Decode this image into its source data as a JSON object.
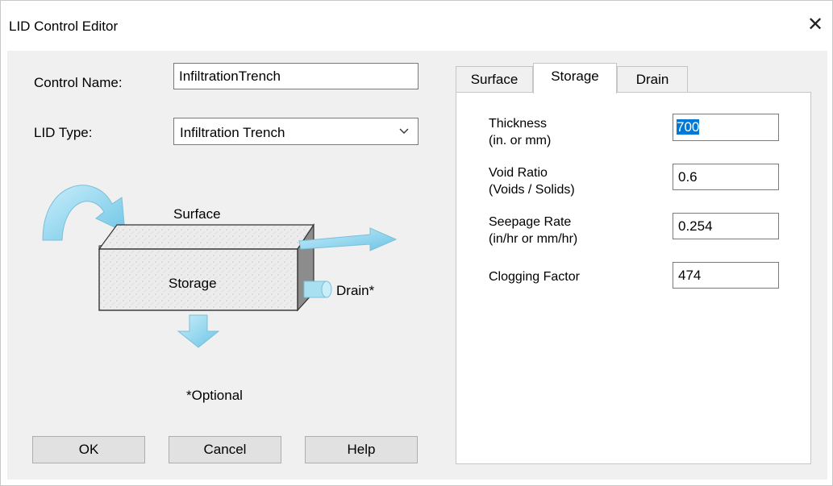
{
  "window": {
    "title": "LID Control Editor",
    "close_glyph": "✕"
  },
  "form": {
    "control_name_label": "Control Name:",
    "control_name_value": "InfiltrationTrench",
    "lid_type_label": "LID Type:",
    "lid_type_value": "Infiltration Trench"
  },
  "diagram": {
    "surface_label": "Surface",
    "storage_label": "Storage",
    "drain_label": "Drain*",
    "optional_note": "*Optional"
  },
  "buttons": {
    "ok_label": "OK",
    "cancel_label": "Cancel",
    "help_label": "Help"
  },
  "tabs": [
    {
      "label": "Surface",
      "active": false
    },
    {
      "label": "Storage",
      "active": true
    },
    {
      "label": "Drain",
      "active": false
    }
  ],
  "storage": {
    "fields": [
      {
        "label_line1": "Thickness",
        "label_line2": "(in. or mm)",
        "value": "700"
      },
      {
        "label_line1": "Void Ratio",
        "label_line2": "(Voids / Solids)",
        "value": "0.6"
      },
      {
        "label_line1": "Seepage Rate",
        "label_line2": "(in/hr or mm/hr)",
        "value": "0.254"
      },
      {
        "label_line1": "Clogging Factor",
        "label_line2": "",
        "value": "474"
      }
    ]
  },
  "colors": {
    "arrow_fill": "#8fd3ec",
    "selection": "#0078d7",
    "box_face": "#e8e8e8"
  }
}
